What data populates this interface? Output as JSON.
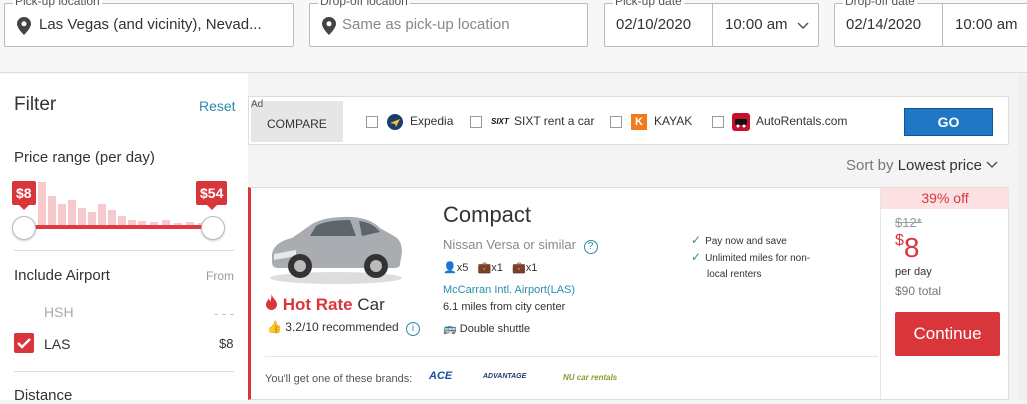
{
  "search": {
    "pickup_location_label": "Pick-up location",
    "pickup_location_value": "Las Vegas (and vicinity), Nevad...",
    "dropoff_location_label": "Drop-off location",
    "dropoff_location_placeholder": "Same as pick-up location",
    "pickup_date_label": "Pick-up date",
    "pickup_date_value": "02/10/2020",
    "pickup_time_value": "10:00 am",
    "dropoff_date_label": "Drop-off date",
    "dropoff_date_value": "02/14/2020",
    "dropoff_time_value": "10:00 am"
  },
  "filter": {
    "title": "Filter",
    "reset_label": "Reset",
    "price_range_title": "Price range (per day)",
    "price_min_tag": "$8",
    "price_max_tag": "$54",
    "include_airport_title": "Include Airport",
    "from_label": "From",
    "airports": [
      {
        "code": "HSH",
        "price": "- - -",
        "checked": false
      },
      {
        "code": "LAS",
        "price": "$8",
        "checked": true
      }
    ],
    "distance_title": "Distance"
  },
  "compare_ad": {
    "ad_label": "Ad",
    "compare_label": "COMPARE",
    "options": [
      {
        "name": "Expedia",
        "icon": "expedia-icon"
      },
      {
        "name": "SIXT rent a car",
        "icon": "sixt-icon"
      },
      {
        "name": "KAYAK",
        "icon": "kayak-icon"
      },
      {
        "name": "AutoRentals.com",
        "icon": "autorentals-icon"
      }
    ],
    "go_label": "GO"
  },
  "sort": {
    "label": "Sort by",
    "value": "Lowest price"
  },
  "result": {
    "car_class": "Compact",
    "car_model": "Nissan Versa or similar",
    "seats": "x5",
    "large_bags": "x1",
    "small_bags": "x1",
    "airport": "McCarran Intl. Airport(LAS)",
    "distance": "6.1 miles from city center",
    "shuttle": "Double shuttle",
    "perks": [
      "Pay now and save",
      "Unlimited miles for non-",
      "local renters"
    ],
    "hot_rate_word1": "Hot Rate",
    "hot_rate_word2": "Car",
    "rating": "3.2/10 recommended",
    "brands_label": "You'll get one of these brands:",
    "brands": [
      "ACE",
      "ADVANTAGE",
      "NU car rentals"
    ],
    "discount": "39% off",
    "old_price": "$12*",
    "new_price_currency": "$",
    "new_price": "8",
    "per_day": "per day",
    "total": "$90 total",
    "continue_label": "Continue"
  },
  "colors": {
    "accent_red": "#d9363c",
    "link_teal": "#2a8da8",
    "go_blue": "#1f77c6"
  }
}
